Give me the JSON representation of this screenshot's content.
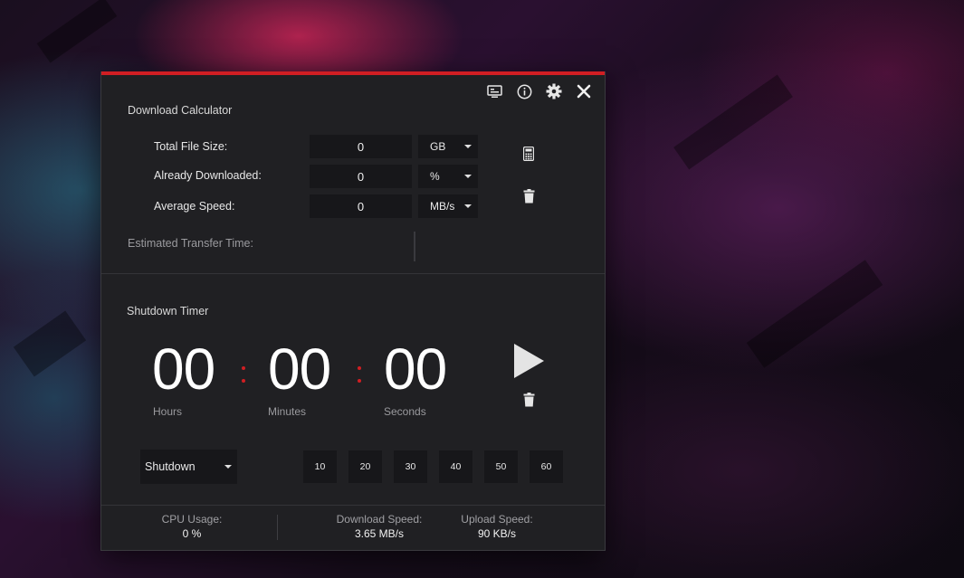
{
  "window": {
    "accent_color": "#d11e23",
    "toolbar_icons": [
      "overlay-monitor-icon",
      "info-icon",
      "gear-icon",
      "close-icon"
    ]
  },
  "download_calculator": {
    "title": "Download Calculator",
    "rows": [
      {
        "label": "Total File Size:",
        "value": "0",
        "unit": "GB"
      },
      {
        "label": "Already Downloaded:",
        "value": "0",
        "unit": "%"
      },
      {
        "label": "Average Speed:",
        "value": "0",
        "unit": "MB/s"
      }
    ],
    "estimated_label": "Estimated Transfer Time:",
    "estimated_value": "",
    "icons": [
      "calculator-icon",
      "trash-icon"
    ]
  },
  "shutdown_timer": {
    "title": "Shutdown Timer",
    "hours": "00",
    "minutes": "00",
    "seconds": "00",
    "hours_label": "Hours",
    "minutes_label": "Minutes",
    "seconds_label": "Seconds",
    "action": "Shutdown",
    "quick_minutes": [
      "10",
      "20",
      "30",
      "40",
      "50",
      "60"
    ],
    "icons": [
      "play-icon",
      "trash-icon"
    ]
  },
  "stats": {
    "cpu_label": "CPU Usage:",
    "cpu_value": "0 %",
    "download_label": "Download Speed:",
    "download_value": "3.65 MB/s",
    "upload_label": "Upload Speed:",
    "upload_value": "90 KB/s"
  }
}
